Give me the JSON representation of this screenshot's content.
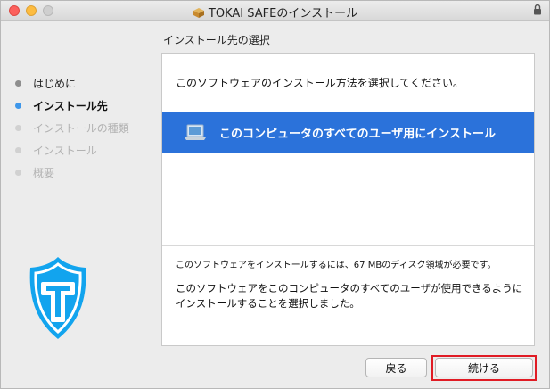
{
  "window": {
    "title": "TOKAI SAFEのインストール",
    "controls": [
      "close",
      "minimize",
      "zoom"
    ],
    "title_icon": "package-icon",
    "lock_icon": "lock-icon"
  },
  "header": {
    "title": "インストール先の選択"
  },
  "sidebar": {
    "steps": [
      {
        "label": "はじめに",
        "state": "done"
      },
      {
        "label": "インストール先",
        "state": "current"
      },
      {
        "label": "インストールの種類",
        "state": "pending"
      },
      {
        "label": "インストール",
        "state": "pending"
      },
      {
        "label": "概要",
        "state": "pending"
      }
    ],
    "logo": "tokai-safe-shield-logo"
  },
  "panel": {
    "instruction": "このソフトウェアのインストール方法を選択してください。",
    "option": {
      "label": "このコンピュータのすべてのユーザ用にインストール",
      "icon": "laptop-icon",
      "selected": true
    },
    "space_note": "このソフトウェアをインストールするには、67 MBのディスク領域が必要です。",
    "description": "このソフトウェアをこのコンピュータのすべてのユーザが使用できるようにインストールすることを選択しました。"
  },
  "buttons": {
    "back": "戻る",
    "continue": "続ける"
  },
  "colors": {
    "accent": "#2b72da",
    "current_step_dot": "#3e97ea",
    "logo_blue": "#12a4ee",
    "highlight": "#e01b24"
  }
}
